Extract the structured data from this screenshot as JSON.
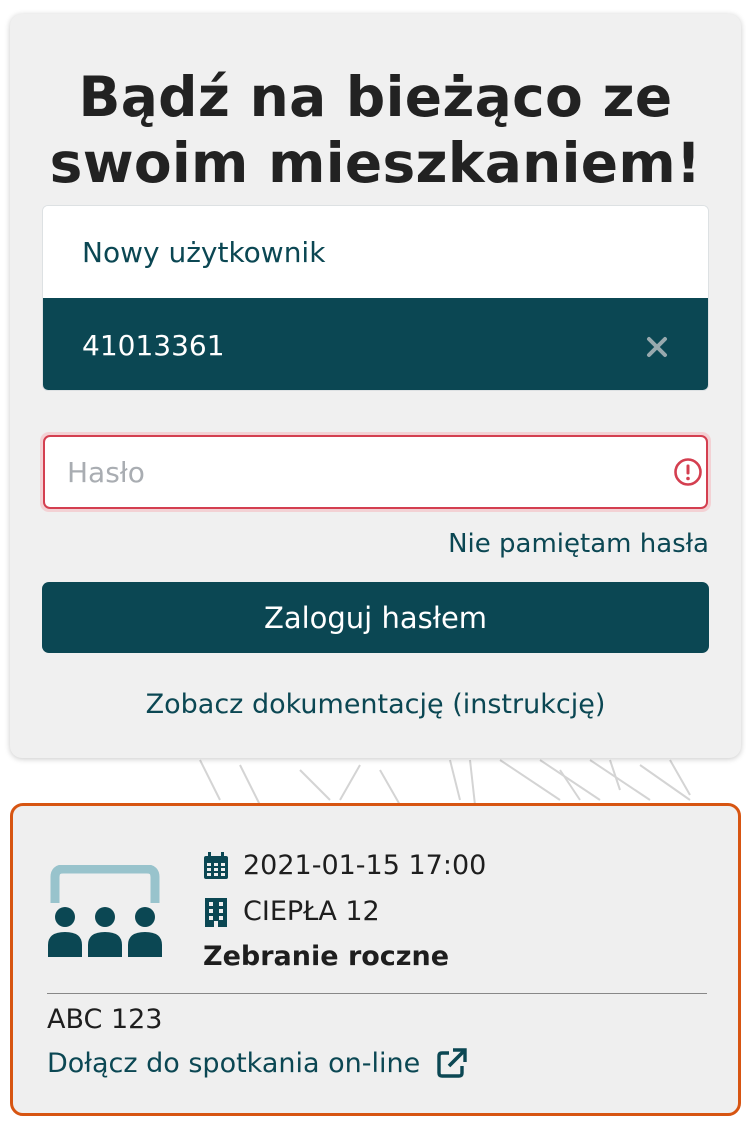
{
  "login": {
    "title_line1": "Bądź na bieżąco ze",
    "title_line2": "swoim mieszkaniem!",
    "users": {
      "new_user_label": "Nowy użytkownik",
      "selected_user": "41013361",
      "close_icon": "close-icon"
    },
    "password": {
      "placeholder": "Hasło",
      "value": "",
      "error_icon": "exclamation-circle-icon",
      "error_color": "#d43f50"
    },
    "forgot_password_label": "Nie pamiętam hasła",
    "login_button_label": "Zaloguj hasłem",
    "docs_link_label": "Zobacz dokumentację (instrukcję)"
  },
  "meeting": {
    "icon": "meeting-room-icon",
    "date_icon": "calendar-icon",
    "date": "2021-01-15 17:00",
    "building_icon": "building-icon",
    "building": "CIEPŁA 12",
    "title": "Zebranie roczne",
    "code": "ABC 123",
    "join_label": "Dołącz do spotkania on-line",
    "join_icon": "external-link-icon"
  },
  "colors": {
    "primary": "#0b4753",
    "accent_light": "#98c3cc",
    "highlight_border": "#d75512",
    "error": "#d43f50"
  }
}
